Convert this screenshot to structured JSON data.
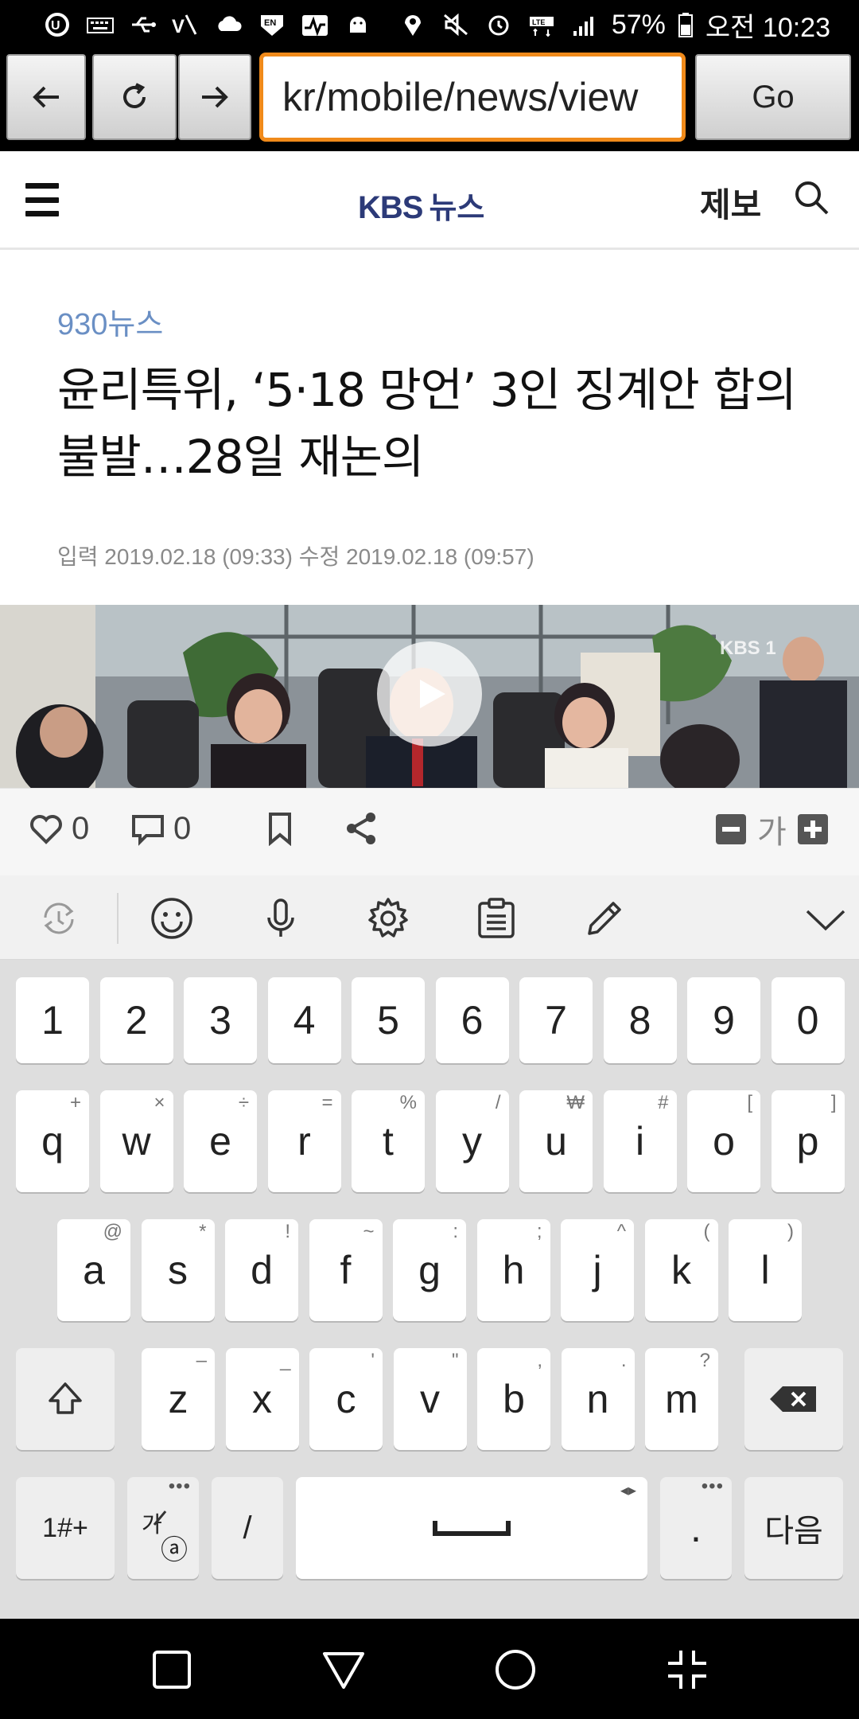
{
  "status_bar": {
    "battery": "57%",
    "time": "오전 10:23",
    "left_icons": [
      "uplus-icon",
      "keyboard-icon",
      "usb-icon",
      "volte-icon",
      "cloud-icon",
      "en-badge-icon",
      "pulse-icon",
      "android-icon"
    ],
    "right_icons": [
      "location-icon",
      "mute-icon",
      "alarm-icon",
      "lte-icon",
      "signal-icon",
      "battery-icon"
    ]
  },
  "browser": {
    "url": "kr/mobile/news/view",
    "go_label": "Go"
  },
  "site": {
    "logo_brand": "KBS",
    "logo_suffix": "뉴스",
    "report_label": "제보"
  },
  "article": {
    "section": "930뉴스",
    "headline": "윤리특위, ‘5·18 망언’ 3인 징계안 합의 불발…28일 재논의",
    "dateline": "입력 2019.02.18 (09:33) 수정 2019.02.18 (09:57)",
    "watermark": "KBS 1"
  },
  "actions": {
    "like_count": "0",
    "comment_count": "0",
    "font_label": "가"
  },
  "keyboard": {
    "numbers": [
      "1",
      "2",
      "3",
      "4",
      "5",
      "6",
      "7",
      "8",
      "9",
      "0"
    ],
    "row1": [
      [
        "q",
        "+"
      ],
      [
        "w",
        "×"
      ],
      [
        "e",
        "÷"
      ],
      [
        "r",
        "="
      ],
      [
        "t",
        "%"
      ],
      [
        "y",
        "/"
      ],
      [
        "u",
        "₩"
      ],
      [
        "i",
        "#"
      ],
      [
        "o",
        "["
      ],
      [
        "p",
        "]"
      ]
    ],
    "row2": [
      [
        "a",
        "@"
      ],
      [
        "s",
        "*"
      ],
      [
        "d",
        "!"
      ],
      [
        "f",
        "~"
      ],
      [
        "g",
        ":"
      ],
      [
        "h",
        ";"
      ],
      [
        "j",
        "^"
      ],
      [
        "k",
        "("
      ],
      [
        "l",
        ")"
      ]
    ],
    "row3": [
      [
        "z",
        "–"
      ],
      [
        "x",
        "_"
      ],
      [
        "c",
        "'"
      ],
      [
        "v",
        "\""
      ],
      [
        "b",
        ","
      ],
      [
        "n",
        "."
      ],
      [
        "m",
        "?"
      ]
    ],
    "sym_label": "1#+",
    "lang_label_top": "가",
    "lang_label_bottom": "ⓐ",
    "slash_label": "/",
    "period_label": ".",
    "enter_label": "다음",
    "space_hint": "◂▸"
  },
  "colors": {
    "url_border": "#f08a1a",
    "logo": "#2c3a78",
    "section": "#6a8fc4"
  }
}
